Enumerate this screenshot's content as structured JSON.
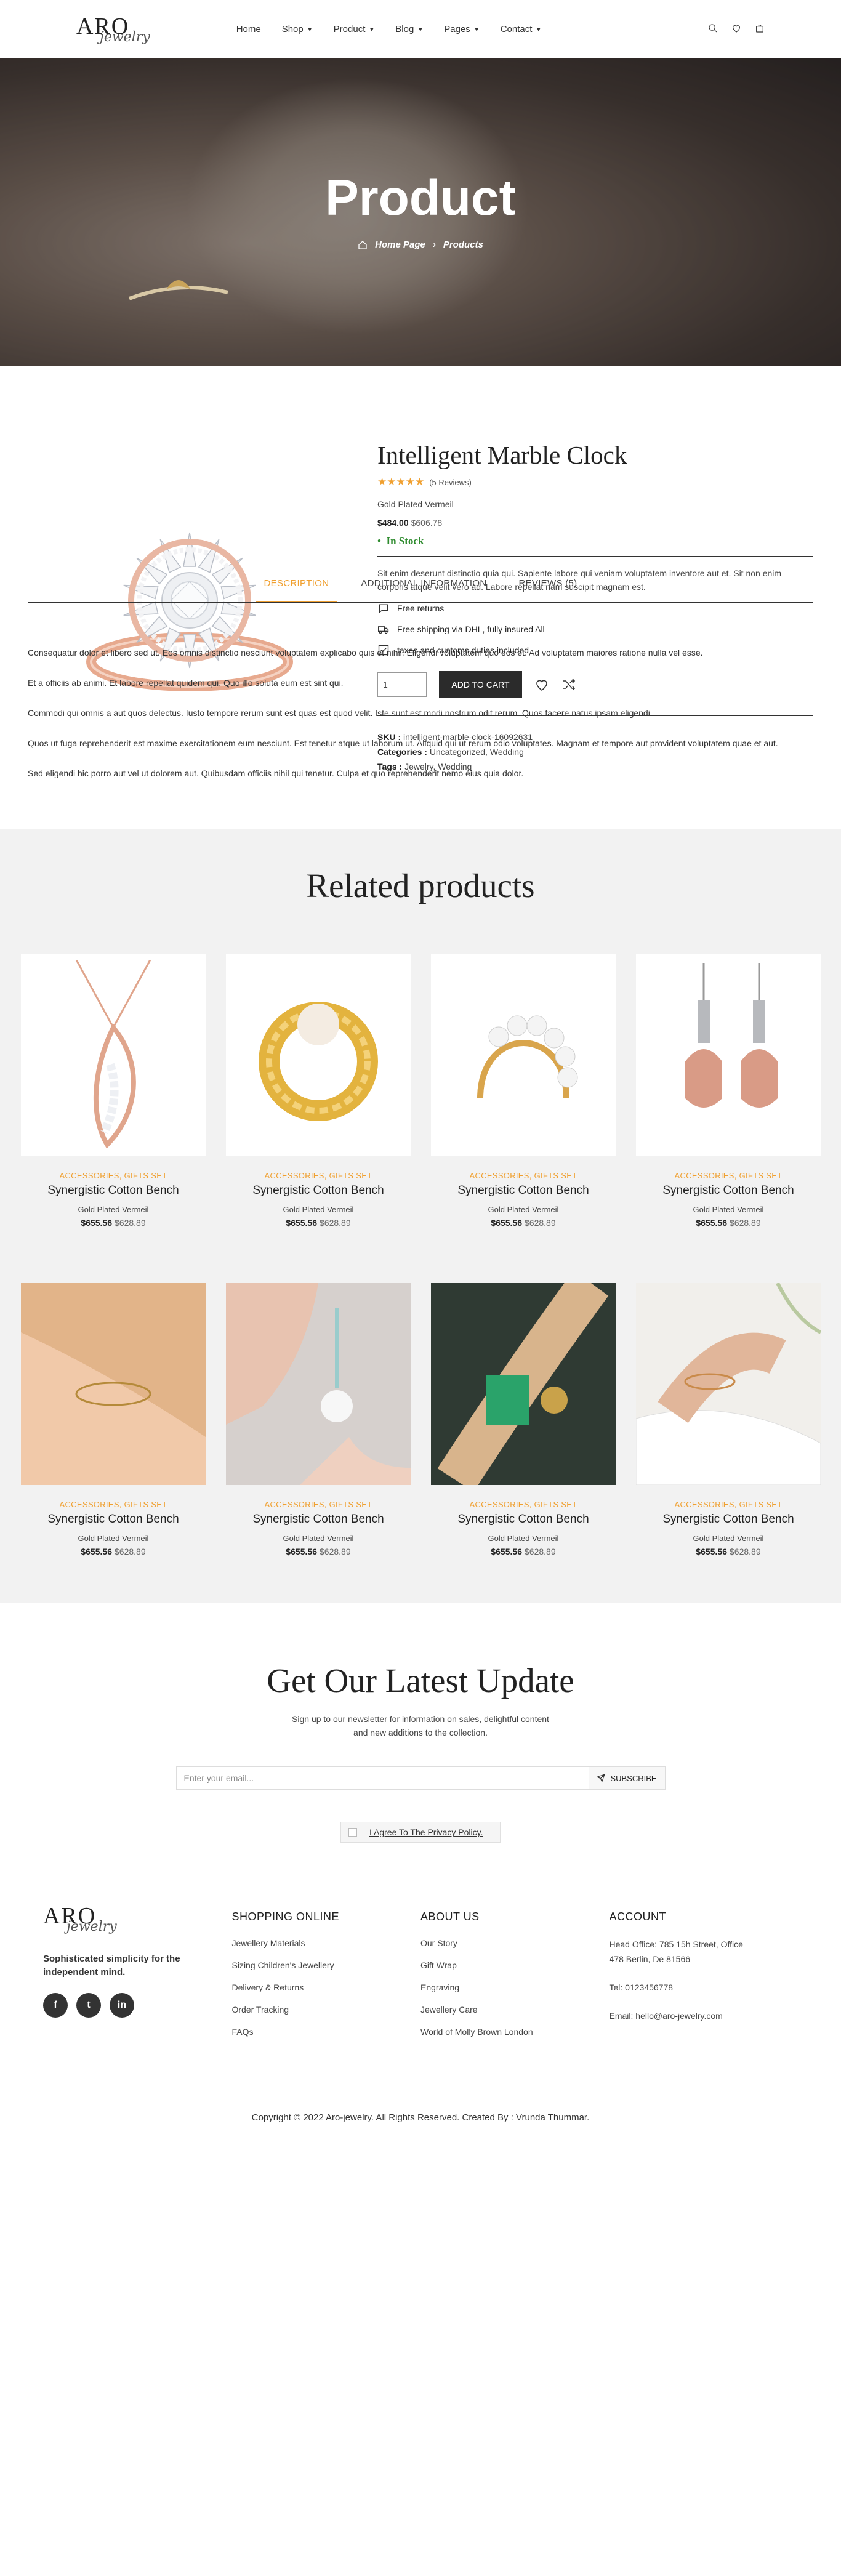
{
  "header": {
    "logo_main": "ARO",
    "logo_sub": "jewelry",
    "nav": [
      {
        "label": "Home",
        "caret": false
      },
      {
        "label": "Shop",
        "caret": true
      },
      {
        "label": "Product",
        "caret": true
      },
      {
        "label": "Blog",
        "caret": true
      },
      {
        "label": "Pages",
        "caret": true
      },
      {
        "label": "Contact",
        "caret": true
      }
    ],
    "icons": [
      "search-icon",
      "heart-icon",
      "bag-icon"
    ]
  },
  "hero": {
    "title": "Product",
    "crumb_home": "Home Page",
    "crumb_current": "Products"
  },
  "product": {
    "title": "Intelligent Marble Clock",
    "rating": 5,
    "reviews": "(5 Reviews)",
    "gold": "Gold Plated Vermeil",
    "price": "$484.00",
    "old_price": "$606.78",
    "stock": "In Stock",
    "description": "Sit enim deserunt distinctio quia qui. Sapiente labore qui veniam voluptatem inventore aut et. Sit non enim corporis atque velit vero ad. Labore repellat nam suscipit magnam est.",
    "features": [
      {
        "icon": "chat-bubble-icon",
        "label": "Free returns"
      },
      {
        "icon": "truck-icon",
        "label": "Free shipping via DHL, fully insured All"
      },
      {
        "icon": "checkbox-icon",
        "label": "taxes and customs duties included"
      }
    ],
    "qty": "1",
    "add_to_cart": "ADD TO CART",
    "sku_label": "SKU :",
    "sku": "intelligent-marble-clock-16092631",
    "categories_label": "Categories :",
    "categories": "Uncategorized, Wedding",
    "tags_label": "Tags :",
    "tags": "Jewelry, Wedding"
  },
  "tabs": [
    {
      "label": "DESCRIPTION",
      "active": true
    },
    {
      "label": "ADDITIONAL INFORMATION",
      "active": false
    },
    {
      "label": "REVIEWS (5)",
      "active": false
    }
  ],
  "description_paragraphs": [
    "Consequatur dolor et libero sed ut. Eos omnis distinctio nesciunt voluptatem explicabo quis et nihil. Eligendi voluptatem quo eos et. Ad voluptatem maiores ratione nulla vel esse.",
    "Et a officiis ab animi. Et labore repellat quidem qui. Quo illo soluta eum est sint qui.",
    "Commodi qui omnis a aut quos delectus. Iusto tempore rerum sunt est quas est quod velit. Iste sunt est modi nostrum odit rerum. Quos facere natus ipsam eligendi.",
    "Quos ut fuga reprehenderit est maxime exercitationem eum nesciunt. Est tenetur atque ut laborum ut. Aliquid qui ut rerum odio voluptates. Magnam et tempore aut provident voluptatem quae et aut.",
    "Sed eligendi hic porro aut vel ut dolorem aut. Quibusdam officiis nihil qui tenetur. Culpa et quo reprehenderit nemo eius quia dolor."
  ],
  "related": {
    "title": "Related products",
    "items": [
      {
        "cat": "ACCESSORIES, GIFTS SET",
        "name": "Synergistic Cotton Bench",
        "gold": "Gold Plated Vermeil",
        "price": "$655.56",
        "old": "$628.89",
        "bg": "#ffffff",
        "kind": "necklace"
      },
      {
        "cat": "ACCESSORIES, GIFTS SET",
        "name": "Synergistic Cotton Bench",
        "gold": "Gold Plated Vermeil",
        "price": "$655.56",
        "old": "$628.89",
        "bg": "#ffffff",
        "kind": "gold-ring"
      },
      {
        "cat": "ACCESSORIES, GIFTS SET",
        "name": "Synergistic Cotton Bench",
        "gold": "Gold Plated Vermeil",
        "price": "$655.56",
        "old": "$628.89",
        "bg": "#ffffff",
        "kind": "pearl-ring"
      },
      {
        "cat": "ACCESSORIES, GIFTS SET",
        "name": "Synergistic Cotton Bench",
        "gold": "Gold Plated Vermeil",
        "price": "$655.56",
        "old": "$628.89",
        "bg": "#ffffff",
        "kind": "earrings"
      },
      {
        "cat": "ACCESSORIES, GIFTS SET",
        "name": "Synergistic Cotton Bench",
        "gold": "Gold Plated Vermeil",
        "price": "$655.56",
        "old": "$628.89",
        "bg": "#d9a679",
        "kind": "photo-bracelet"
      },
      {
        "cat": "ACCESSORIES, GIFTS SET",
        "name": "Synergistic Cotton Bench",
        "gold": "Gold Plated Vermeil",
        "price": "$655.56",
        "old": "$628.89",
        "bg": "#d8d2cf",
        "kind": "photo-earring"
      },
      {
        "cat": "ACCESSORIES, GIFTS SET",
        "name": "Synergistic Cotton Bench",
        "gold": "Gold Plated Vermeil",
        "price": "$655.56",
        "old": "$628.89",
        "bg": "#3b4a3f",
        "kind": "photo-green"
      },
      {
        "cat": "ACCESSORIES, GIFTS SET",
        "name": "Synergistic Cotton Bench",
        "gold": "Gold Plated Vermeil",
        "price": "$655.56",
        "old": "$628.89",
        "bg": "#eeece8",
        "kind": "photo-wrist"
      }
    ]
  },
  "newsletter": {
    "title": "Get Our Latest Update",
    "text1": "Sign up to our newsletter for information on sales, delightful content",
    "text2": "and new additions to the collection.",
    "placeholder": "Enter your email...",
    "button": "SUBSCRIBE",
    "agree": "I Agree To The Privacy Policy."
  },
  "footer": {
    "tagline1": "Sophisticated simplicity for the",
    "tagline2": "independent mind.",
    "social": [
      "f",
      "t",
      "in"
    ],
    "shopping_title": "SHOPPING ONLINE",
    "shopping": [
      "Jewellery Materials",
      "Sizing Children's Jewellery",
      "Delivery & Returns",
      "Order Tracking",
      "FAQs"
    ],
    "about_title": "ABOUT US",
    "about": [
      "Our Story",
      "Gift Wrap",
      "Engraving",
      "Jewellery Care",
      "World of Molly Brown London"
    ],
    "account_title": "ACCOUNT",
    "address1": "Head Office: 785 15h Street, Office",
    "address2": "478 Berlin, De 81566",
    "tel": "Tel: 0123456778",
    "email": "Email: hello@aro-jewelry.com",
    "copyright": "Copyright © 2022 Aro-jewelry. All Rights Reserved. Created By : Vrunda Thummar."
  },
  "colors": {
    "accent": "#f0a030",
    "dark": "#2b2b2b",
    "stock": "#2e8b2e"
  }
}
